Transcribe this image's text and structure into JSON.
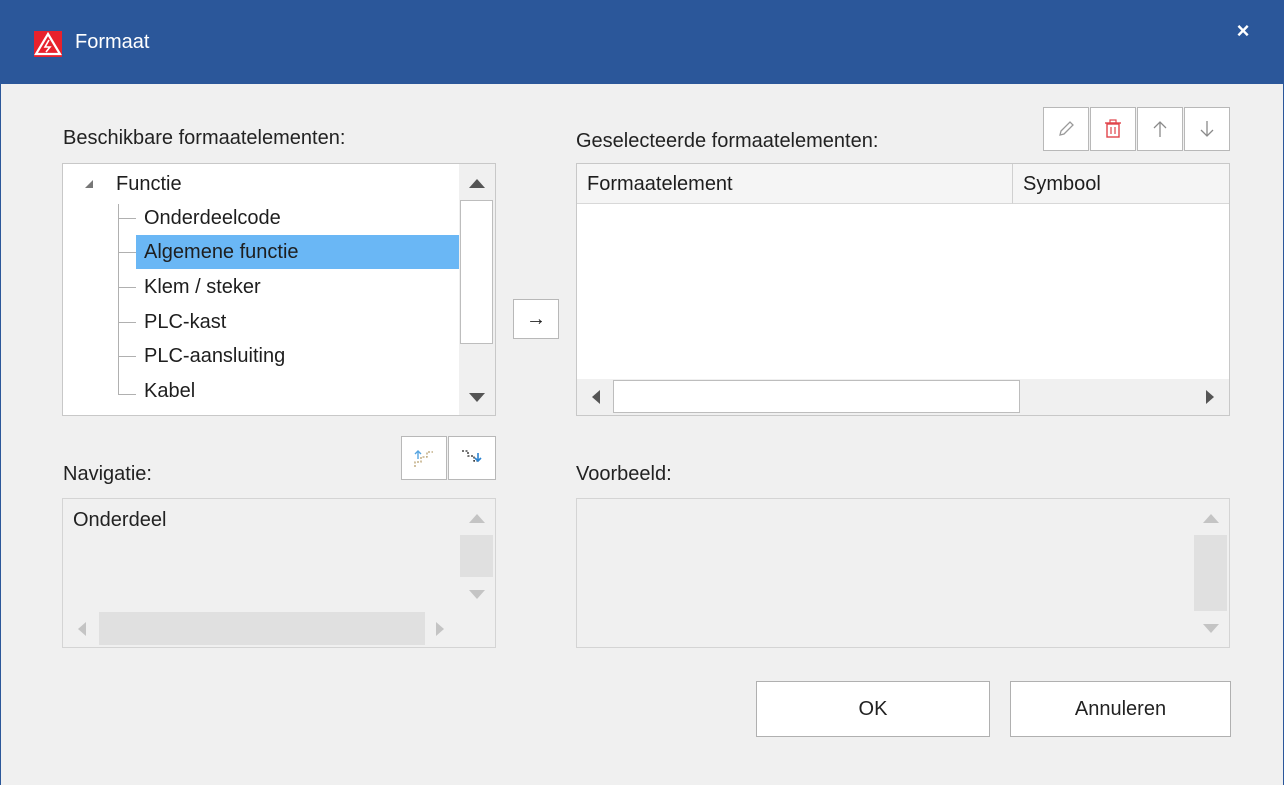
{
  "window": {
    "title": "Formaat",
    "close": "×"
  },
  "available": {
    "label": "Beschikbare formaatelementen:",
    "root": "Functie",
    "items": [
      "Onderdeelcode",
      "Algemene functie",
      "Klem / steker",
      "PLC-kast",
      "PLC-aansluiting",
      "Kabel"
    ],
    "selected_index": 1
  },
  "move_button": "→",
  "selected": {
    "label": "Geselecteerde formaatelementen:",
    "columns": [
      "Formaatelement",
      "Symbool"
    ]
  },
  "navigation": {
    "label": "Navigatie:",
    "value": "Onderdeel"
  },
  "preview": {
    "label": "Voorbeeld:"
  },
  "buttons": {
    "ok": "OK",
    "cancel": "Annuleren"
  },
  "colors": {
    "titlebar": "#2b579a",
    "selection": "#6ab7f5",
    "delete_icon": "#e0444b"
  }
}
